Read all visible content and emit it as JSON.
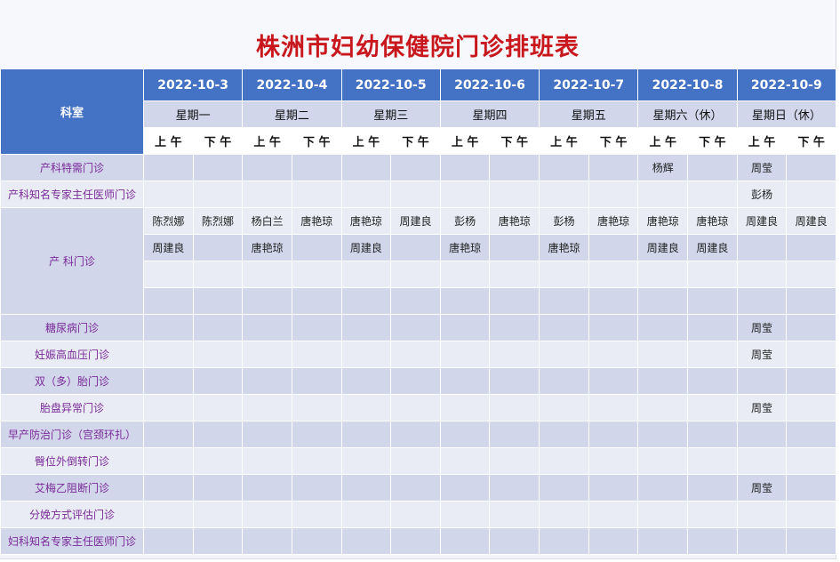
{
  "title": "株洲市妇幼保健院门诊排班表",
  "header": {
    "dept_label": "科室",
    "dates": [
      "2022-10-3",
      "2022-10-4",
      "2022-10-5",
      "2022-10-6",
      "2022-10-7",
      "2022-10-8",
      "2022-10-9"
    ],
    "weekdays": [
      "星期一",
      "星期二",
      "星期三",
      "星期四",
      "星期五",
      "星期六（休）",
      "星期日（休）"
    ],
    "am": "上 午",
    "pm": "下 午"
  },
  "rows": [
    {
      "dept": "产科特需门诊",
      "cells": [
        "",
        "",
        "",
        "",
        "",
        "",
        "",
        "",
        "",
        "",
        "杨辉",
        "",
        "周莹",
        ""
      ]
    },
    {
      "dept": "产科知名专家主任医师门诊",
      "cells": [
        "",
        "",
        "",
        "",
        "",
        "",
        "",
        "",
        "",
        "",
        "",
        "",
        "彭杨",
        ""
      ]
    },
    {
      "dept": "产 科门诊",
      "sub": [
        [
          "陈烈娜",
          "陈烈娜",
          "杨白兰",
          "唐艳琼",
          "唐艳琼",
          "周建良",
          "彭杨",
          "唐艳琼",
          "彭杨",
          "唐艳琼",
          "唐艳琼",
          "唐艳琼",
          "周建良",
          "周建良"
        ],
        [
          "周建良",
          "",
          "唐艳琼",
          "",
          "周建良",
          "",
          "唐艳琼",
          "",
          "唐艳琼",
          "",
          "周建良",
          "周建良",
          "",
          ""
        ],
        [
          "",
          "",
          "",
          "",
          "",
          "",
          "",
          "",
          "",
          "",
          "",
          "",
          "",
          ""
        ],
        [
          "",
          "",
          "",
          "",
          "",
          "",
          "",
          "",
          "",
          "",
          "",
          "",
          "",
          ""
        ]
      ]
    },
    {
      "dept": "糖尿病门诊",
      "cells": [
        "",
        "",
        "",
        "",
        "",
        "",
        "",
        "",
        "",
        "",
        "",
        "",
        "周莹",
        ""
      ]
    },
    {
      "dept": "妊娠高血压门诊",
      "cells": [
        "",
        "",
        "",
        "",
        "",
        "",
        "",
        "",
        "",
        "",
        "",
        "",
        "周莹",
        ""
      ]
    },
    {
      "dept": "双（多）胎门诊",
      "cells": [
        "",
        "",
        "",
        "",
        "",
        "",
        "",
        "",
        "",
        "",
        "",
        "",
        "",
        ""
      ]
    },
    {
      "dept": "胎盘异常门诊",
      "cells": [
        "",
        "",
        "",
        "",
        "",
        "",
        "",
        "",
        "",
        "",
        "",
        "",
        "周莹",
        ""
      ]
    },
    {
      "dept": "早产防治门诊（宫颈环扎）",
      "cells": [
        "",
        "",
        "",
        "",
        "",
        "",
        "",
        "",
        "",
        "",
        "",
        "",
        "",
        ""
      ]
    },
    {
      "dept": "臀位外倒转门诊",
      "cells": [
        "",
        "",
        "",
        "",
        "",
        "",
        "",
        "",
        "",
        "",
        "",
        "",
        "",
        ""
      ]
    },
    {
      "dept": "艾梅乙阻断门诊",
      "cells": [
        "",
        "",
        "",
        "",
        "",
        "",
        "",
        "",
        "",
        "",
        "",
        "",
        "周莹",
        ""
      ]
    },
    {
      "dept": "分娩方式评估门诊",
      "cells": [
        "",
        "",
        "",
        "",
        "",
        "",
        "",
        "",
        "",
        "",
        "",
        "",
        "",
        ""
      ]
    },
    {
      "dept": "妇科知名专家主任医师门诊",
      "cells": [
        "",
        "",
        "",
        "",
        "",
        "",
        "",
        "",
        "",
        "",
        "",
        "",
        "",
        ""
      ]
    }
  ],
  "colors": {
    "title": "#c8181e",
    "header_blue": "#4472c4",
    "band_dark": "#d1d6ea",
    "band_light": "#e9ecf5",
    "dept_text": "#7a2a99"
  }
}
